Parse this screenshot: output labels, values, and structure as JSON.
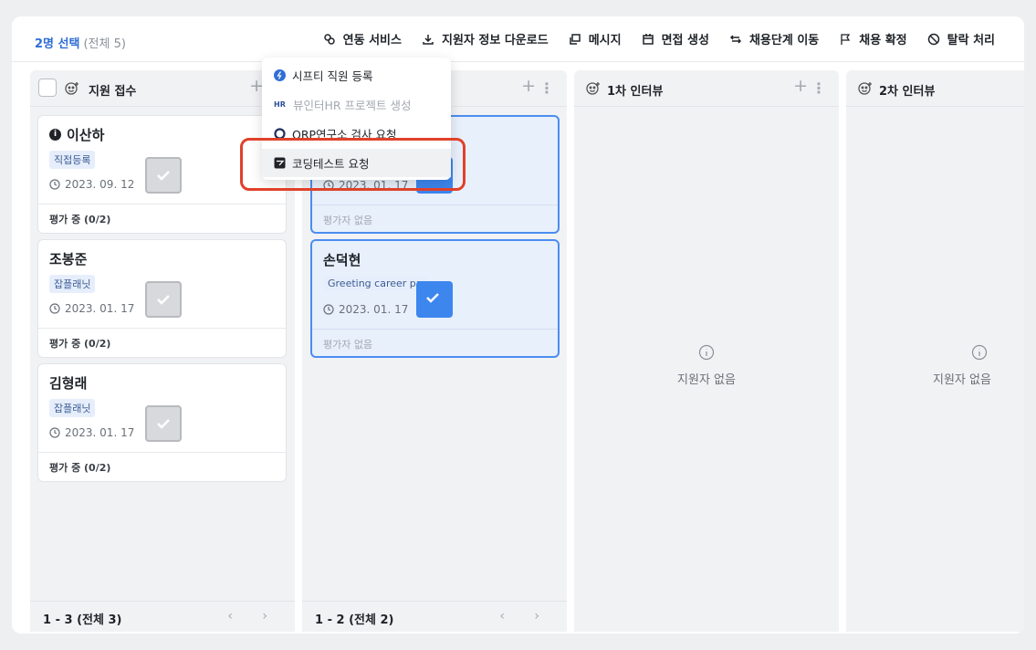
{
  "toolbar": {
    "selected_count": "2명 선택",
    "selected_total": "(전체 5)",
    "actions": [
      {
        "label": "연동 서비스",
        "icon": "link-icon"
      },
      {
        "label": "지원자 정보 다운로드",
        "icon": "download-icon"
      },
      {
        "label": "메시지",
        "icon": "message-icon"
      },
      {
        "label": "면접 생성",
        "icon": "calendar-icon"
      },
      {
        "label": "채용단계 이동",
        "icon": "swap-arrows-icon"
      },
      {
        "label": "채용 확정",
        "icon": "flag-icon"
      },
      {
        "label": "탈락 처리",
        "icon": "block-icon"
      }
    ]
  },
  "columns": [
    {
      "title": "지원 접수",
      "footer": "1 - 3 (전체 3)",
      "cards": [
        {
          "name": "이산하",
          "tag": "직접등록",
          "date": "2023. 09. 12",
          "eval": "평가 중 (0/2)"
        },
        {
          "name": "조봉준",
          "tag": "잡플래닛",
          "date": "2023. 01. 17",
          "eval": "평가 중 (0/2)"
        },
        {
          "name": "김형래",
          "tag": "잡플래닛",
          "date": "2023. 01. 17",
          "eval": "평가 중 (0/2)"
        }
      ]
    },
    {
      "title": "",
      "footer": "1 - 2 (전체 2)",
      "cards": [
        {
          "name": "",
          "tag": "",
          "date": "2023. 01. 17",
          "eval": "평가자 없음"
        },
        {
          "name": "손덕현",
          "tag": "Greeting career pa",
          "date": "2023. 01. 17",
          "eval": "평가자 없음"
        }
      ]
    },
    {
      "title": "1차 인터뷰",
      "empty": "지원자 없음"
    },
    {
      "title": "2차 인터뷰",
      "empty": "지원자 없음"
    }
  ],
  "dropdown": {
    "items": [
      {
        "label": "시프티 직원 등록",
        "icon": "shiftee-icon",
        "enabled": true
      },
      {
        "label": "뷰인터HR 프로젝트 생성",
        "icon": "viewinter-hr-icon",
        "badge": "HR",
        "enabled": false
      },
      {
        "label": "ORP연구소 검사 요청",
        "icon": "orp-ring-icon",
        "enabled": true
      },
      {
        "label": "코딩테스트 요청",
        "icon": "coding-test-icon",
        "enabled": true,
        "highlighted": true
      }
    ]
  },
  "colors": {
    "accent": "#2f6fd6",
    "selected_card_bg": "#e8f0fc",
    "highlight_border": "#e0412a"
  }
}
